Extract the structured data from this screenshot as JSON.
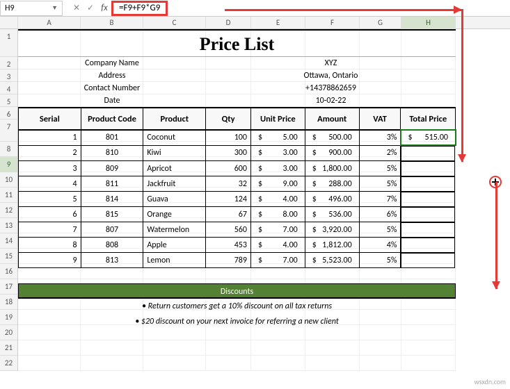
{
  "name_box": "H9",
  "formula": "=F9+F9*G9",
  "columns": [
    "A",
    "B",
    "C",
    "D",
    "E",
    "F",
    "G",
    "H"
  ],
  "title": "Price List",
  "company": [
    {
      "label": "Company Name",
      "value": "XYZ"
    },
    {
      "label": "Address",
      "value": "Ottawa, Ontario"
    },
    {
      "label": "Contact Number",
      "value": "+14378862659"
    },
    {
      "label": "Date",
      "value": "10-02-22"
    }
  ],
  "headers": [
    "Serial",
    "Product Code",
    "Product",
    "Qty",
    "Unit Price",
    "Amount",
    "VAT",
    "Total Price"
  ],
  "rows": [
    {
      "serial": 1,
      "code": 801,
      "product": "Coconut",
      "qty": 100,
      "unit": "5.00",
      "amount": "500.00",
      "vat": "3%",
      "total": "515.00"
    },
    {
      "serial": 2,
      "code": 810,
      "product": "Kiwi",
      "qty": 300,
      "unit": "3.00",
      "amount": "900.00",
      "vat": "2%",
      "total": ""
    },
    {
      "serial": 3,
      "code": 809,
      "product": "Apricot",
      "qty": 600,
      "unit": "3.00",
      "amount": "1,800.00",
      "vat": "5%",
      "total": ""
    },
    {
      "serial": 4,
      "code": 811,
      "product": "Jackfruit",
      "qty": 32,
      "unit": "9.00",
      "amount": "288.00",
      "vat": "5%",
      "total": ""
    },
    {
      "serial": 5,
      "code": 814,
      "product": "Guava",
      "qty": 124,
      "unit": "4.00",
      "amount": "496.00",
      "vat": "7%",
      "total": ""
    },
    {
      "serial": 6,
      "code": 815,
      "product": "Orange",
      "qty": 67,
      "unit": "8.00",
      "amount": "536.00",
      "vat": "6%",
      "total": ""
    },
    {
      "serial": 7,
      "code": 807,
      "product": "Watermelon",
      "qty": 560,
      "unit": "7.00",
      "amount": "3,920.00",
      "vat": "5%",
      "total": ""
    },
    {
      "serial": 8,
      "code": 808,
      "product": "Apple",
      "qty": 453,
      "unit": "4.00",
      "amount": "1,812.00",
      "vat": "4%",
      "total": ""
    },
    {
      "serial": 9,
      "code": 813,
      "product": "Lemon",
      "qty": 789,
      "unit": "7.00",
      "amount": "5,523.00",
      "vat": "5%",
      "total": ""
    }
  ],
  "discounts_title": "Discounts",
  "discount_lines": [
    "• Return customers get a 10% discount on all tax returns",
    "• $20 discount on your next invoice for referring a new client"
  ],
  "row_numbers": [
    1,
    2,
    3,
    4,
    5,
    6,
    7,
    8,
    9,
    10,
    11,
    12,
    13,
    14,
    15,
    16,
    17,
    18,
    19,
    20,
    21,
    22
  ],
  "watermark": "wsxdn.com",
  "chart_data": {
    "type": "table",
    "title": "Price List",
    "columns": [
      "Serial",
      "Product Code",
      "Product",
      "Qty",
      "Unit Price",
      "Amount",
      "VAT",
      "Total Price"
    ],
    "rows": [
      [
        1,
        801,
        "Coconut",
        100,
        5.0,
        500.0,
        0.03,
        515.0
      ],
      [
        2,
        810,
        "Kiwi",
        300,
        3.0,
        900.0,
        0.02,
        null
      ],
      [
        3,
        809,
        "Apricot",
        600,
        3.0,
        1800.0,
        0.05,
        null
      ],
      [
        4,
        811,
        "Jackfruit",
        32,
        9.0,
        288.0,
        0.05,
        null
      ],
      [
        5,
        814,
        "Guava",
        124,
        4.0,
        496.0,
        0.07,
        null
      ],
      [
        6,
        815,
        "Orange",
        67,
        8.0,
        536.0,
        0.06,
        null
      ],
      [
        7,
        807,
        "Watermelon",
        560,
        7.0,
        3920.0,
        0.05,
        null
      ],
      [
        8,
        808,
        "Apple",
        453,
        4.0,
        1812.0,
        0.04,
        null
      ],
      [
        9,
        813,
        "Lemon",
        789,
        7.0,
        5523.0,
        0.05,
        null
      ]
    ]
  }
}
